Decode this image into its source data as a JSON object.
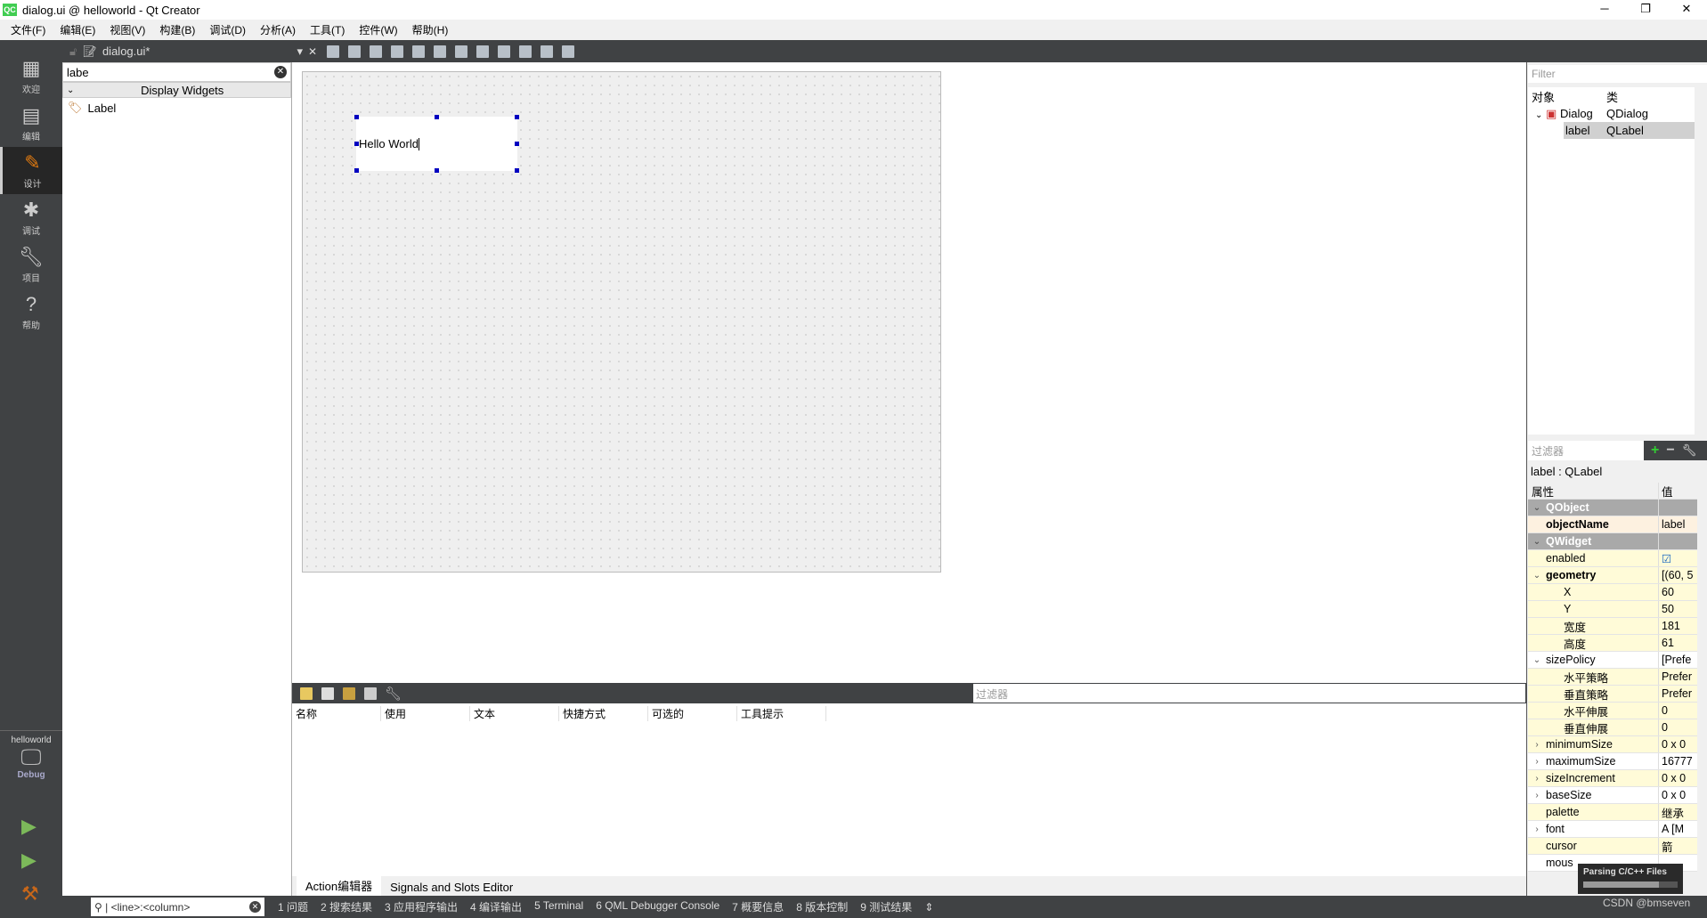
{
  "window": {
    "title": "dialog.ui @ helloworld - Qt Creator",
    "logo": "QC"
  },
  "menu": [
    "文件(F)",
    "编辑(E)",
    "视图(V)",
    "构建(B)",
    "调试(D)",
    "分析(A)",
    "工具(T)",
    "控件(W)",
    "帮助(H)"
  ],
  "toolbar": {
    "file": "dialog.ui*"
  },
  "modes": [
    {
      "label": "欢迎",
      "icon": "grid-icon"
    },
    {
      "label": "编辑",
      "icon": "document-icon"
    },
    {
      "label": "设计",
      "icon": "pencil-icon"
    },
    {
      "label": "调试",
      "icon": "bug-icon"
    },
    {
      "label": "项目",
      "icon": "wrench-icon"
    },
    {
      "label": "帮助",
      "icon": "help-icon"
    }
  ],
  "kit": {
    "project": "helloworld",
    "config": "Debug"
  },
  "widgetbox": {
    "search": "labe",
    "category": "Display Widgets",
    "item": "Label"
  },
  "form": {
    "label_text": "Hello World"
  },
  "action_editor": {
    "filter_placeholder": "过滤器",
    "columns": [
      "名称",
      "使用",
      "文本",
      "快捷方式",
      "可选的",
      "工具提示"
    ],
    "tabs": [
      "Action编辑器",
      "Signals and Slots Editor"
    ]
  },
  "object_inspector": {
    "filter_placeholder": "Filter",
    "columns": [
      "对象",
      "类"
    ],
    "rows": [
      {
        "object": "Dialog",
        "class": "QDialog"
      },
      {
        "object": "label",
        "class": "QLabel"
      }
    ]
  },
  "property_editor": {
    "filter_placeholder": "过滤器",
    "title": "label : QLabel",
    "columns": [
      "属性",
      "值"
    ],
    "rows": [
      {
        "name": "QObject",
        "value": "",
        "type": "group",
        "exp": "⌄"
      },
      {
        "name": "objectName",
        "value": "label",
        "type": "o",
        "bold": true
      },
      {
        "name": "QWidget",
        "value": "",
        "type": "group",
        "exp": "⌄"
      },
      {
        "name": "enabled",
        "value": "☑",
        "type": "y"
      },
      {
        "name": "geometry",
        "value": "[(60, 5",
        "type": "y",
        "bold": true,
        "exp": "⌄"
      },
      {
        "name": "X",
        "value": "60",
        "type": "y",
        "sub": true
      },
      {
        "name": "Y",
        "value": "50",
        "type": "y",
        "sub": true
      },
      {
        "name": "宽度",
        "value": "181",
        "type": "y",
        "sub": true
      },
      {
        "name": "高度",
        "value": "61",
        "type": "y",
        "sub": true
      },
      {
        "name": "sizePolicy",
        "value": "[Prefe",
        "type": "w",
        "exp": "⌄"
      },
      {
        "name": "水平策略",
        "value": "Prefer",
        "type": "y",
        "sub": true
      },
      {
        "name": "垂直策略",
        "value": "Prefer",
        "type": "y",
        "sub": true
      },
      {
        "name": "水平伸展",
        "value": "0",
        "type": "y",
        "sub": true
      },
      {
        "name": "垂直伸展",
        "value": "0",
        "type": "y",
        "sub": true
      },
      {
        "name": "minimumSize",
        "value": "0 x 0",
        "type": "y",
        "exp": "›"
      },
      {
        "name": "maximumSize",
        "value": "16777",
        "type": "w",
        "exp": "›"
      },
      {
        "name": "sizeIncrement",
        "value": "0 x 0",
        "type": "y",
        "exp": "›"
      },
      {
        "name": "baseSize",
        "value": "0 x 0",
        "type": "w",
        "exp": "›"
      },
      {
        "name": "palette",
        "value": "继承",
        "type": "y"
      },
      {
        "name": "font",
        "value": "A [M",
        "type": "w",
        "exp": "›"
      },
      {
        "name": "cursor",
        "value": "箭",
        "type": "y"
      },
      {
        "name": "mous",
        "value": "",
        "type": "w"
      }
    ]
  },
  "tooltip": {
    "text": "Parsing C/C++ Files",
    "progress": 0.8
  },
  "statusbar": {
    "locator_placeholder": "<line>:<column>",
    "panes": [
      "1 问题",
      "2 搜索结果",
      "3 应用程序输出",
      "4 编译输出",
      "5 Terminal",
      "6 QML Debugger Console",
      "7 概要信息",
      "8 版本控制",
      "9 测试结果"
    ]
  },
  "watermark": "CSDN @bmseven"
}
